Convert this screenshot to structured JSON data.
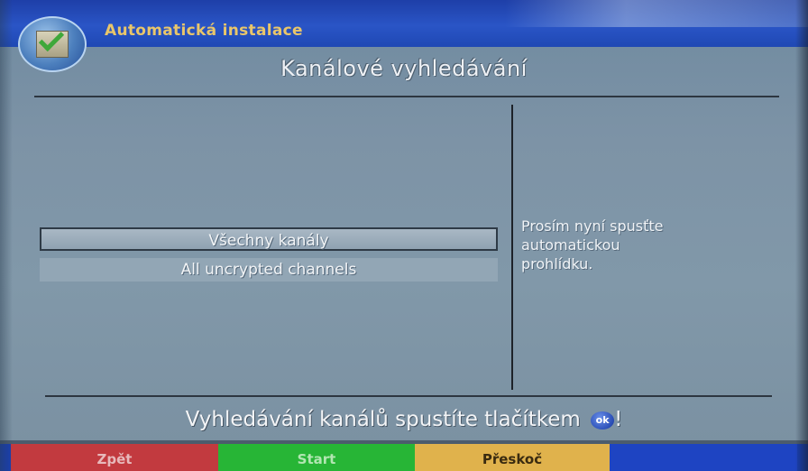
{
  "header": {
    "app_title": "Automatická instalace",
    "logo_icon": "checkbox-check-icon"
  },
  "page": {
    "title": "Kanálové vyhledávání"
  },
  "channel_list": {
    "items": [
      {
        "label": "Všechny kanály",
        "selected": true
      },
      {
        "label": "All uncrypted channels",
        "selected": false
      }
    ]
  },
  "info": {
    "line1": "Prosím nyní spusťte",
    "line2": "automatickou",
    "line3": "prohlídku."
  },
  "hint": {
    "text": "Vyhledávání kanálů spustíte tlačítkem",
    "ok_label": "ok",
    "suffix": "!"
  },
  "function_buttons": {
    "red": "Zpět",
    "green": "Start",
    "yellow": "Přeskoč",
    "blue": ""
  },
  "colors": {
    "red": "#c23a3f",
    "green": "#27b536",
    "yellow": "#e0b24c",
    "blue": "#1e44c2",
    "title_gold": "#e9c66a"
  }
}
